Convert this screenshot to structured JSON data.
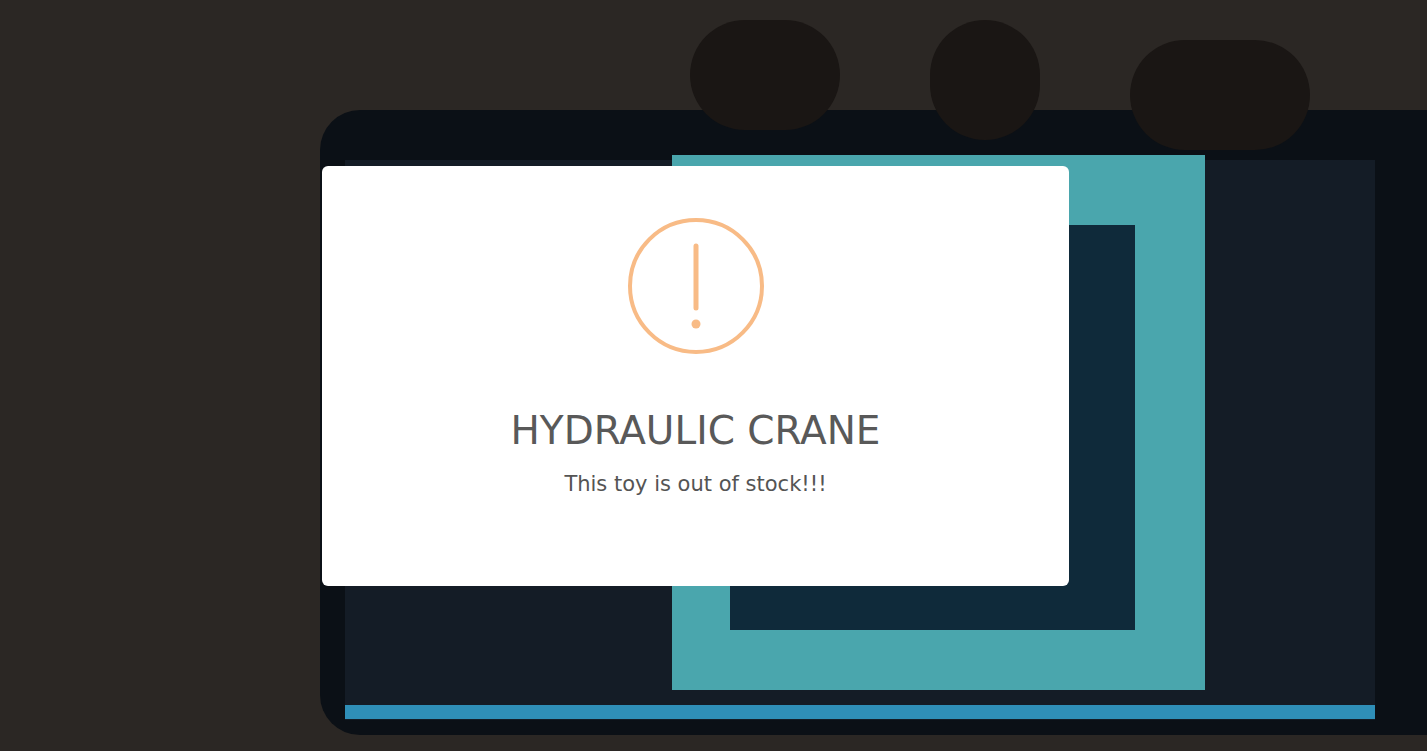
{
  "dialog": {
    "title": "HYDRAULIC CRANE",
    "message": "This toy is out of stock!!!"
  }
}
